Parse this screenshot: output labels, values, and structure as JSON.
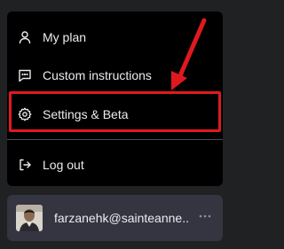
{
  "menu": {
    "items": [
      {
        "label": "My plan",
        "icon": "user-icon"
      },
      {
        "label": "Custom instructions",
        "icon": "message-icon"
      },
      {
        "label": "Settings & Beta",
        "icon": "gear-icon"
      },
      {
        "label": "Log out",
        "icon": "logout-icon"
      }
    ]
  },
  "annotation": {
    "highlight_color": "#e0191f",
    "highlighted_item": "Settings & Beta"
  },
  "user": {
    "email": "farzanehk@sainteanne....",
    "more_icon": "more-horizontal-icon"
  },
  "colors": {
    "background": "#202123",
    "menu_background": "#000000",
    "user_row_background": "#343541",
    "text": "#ececf1"
  }
}
